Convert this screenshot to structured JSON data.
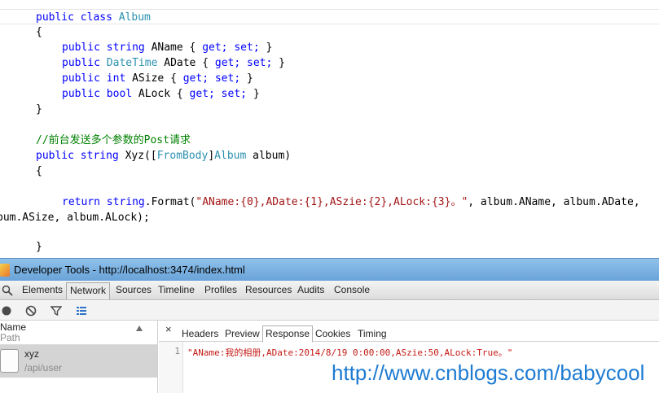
{
  "code_editor": {
    "line1": {
      "kw": "public class ",
      "ty": "Album"
    },
    "line2": {
      "text": "{"
    },
    "line3": {
      "kw1": "public string ",
      "name": "AName ",
      "brace_open": "{ ",
      "kw2": "get; set;",
      "brace_close": " }"
    },
    "line4": {
      "kw1": "public ",
      "ty": "DateTime",
      "name": " ADate ",
      "brace_open": "{ ",
      "kw2": "get; set;",
      "brace_close": " }"
    },
    "line5": {
      "kw1": "public int ",
      "name": "ASize ",
      "brace_open": "{ ",
      "kw2": "get; set;",
      "brace_close": " }"
    },
    "line6": {
      "kw1": "public bool ",
      "name": "ALock ",
      "brace_open": "{ ",
      "kw2": "get; set;",
      "brace_close": " }"
    },
    "line7": {
      "text": "}"
    },
    "line8": {
      "comment": "//前台发送多个参数的Post请求"
    },
    "line9": {
      "kw": "public string ",
      "name": "Xyz([",
      "ty1": "FromBody",
      "mid": "]",
      "ty2": "Album",
      "rest": " album)"
    },
    "line10": {
      "text": "{"
    },
    "line11": {
      "kw": "return string",
      "mid": ".Format(",
      "str": "\"AName:{0},ADate:{1},ASzie:{2},ALock:{3}。\"",
      "rest": ", album.AName, album.ADate,"
    },
    "line12": {
      "text": "bum.ASize, album.ALock);"
    },
    "line13": {
      "text": "}"
    }
  },
  "devtools": {
    "window_title": "Developer Tools - http://localhost:3474/index.html",
    "tabs": [
      "Elements",
      "Network",
      "Sources",
      "Timeline",
      "Profiles",
      "Resources",
      "Audits",
      "Console"
    ],
    "active_tab": "Network",
    "toolbar_icons": [
      "record-icon",
      "clear-icon",
      "filter-icon",
      "list-view-icon"
    ],
    "request_list": {
      "header_name": "Name",
      "header_path": "Path",
      "rows": [
        {
          "name": "xyz",
          "path": "/api/user"
        }
      ]
    },
    "detail_tabs": [
      "Headers",
      "Preview",
      "Response",
      "Cookies",
      "Timing"
    ],
    "active_detail_tab": "Response",
    "close_symbol": "×",
    "response": {
      "line_number": "1",
      "body": "\"AName:我的相册,ADate:2014/8/19 0:00:00,ASzie:50,ALock:True。\""
    }
  },
  "watermark": "http://www.cnblogs.com/babycool",
  "colors": {
    "keyword": "#0000ff",
    "type": "#2b91af",
    "string": "#a31515",
    "comment": "#008000",
    "response_text": "#c41a16",
    "watermark": "#1e7bd2",
    "titlebar": "#8fc1ea"
  }
}
